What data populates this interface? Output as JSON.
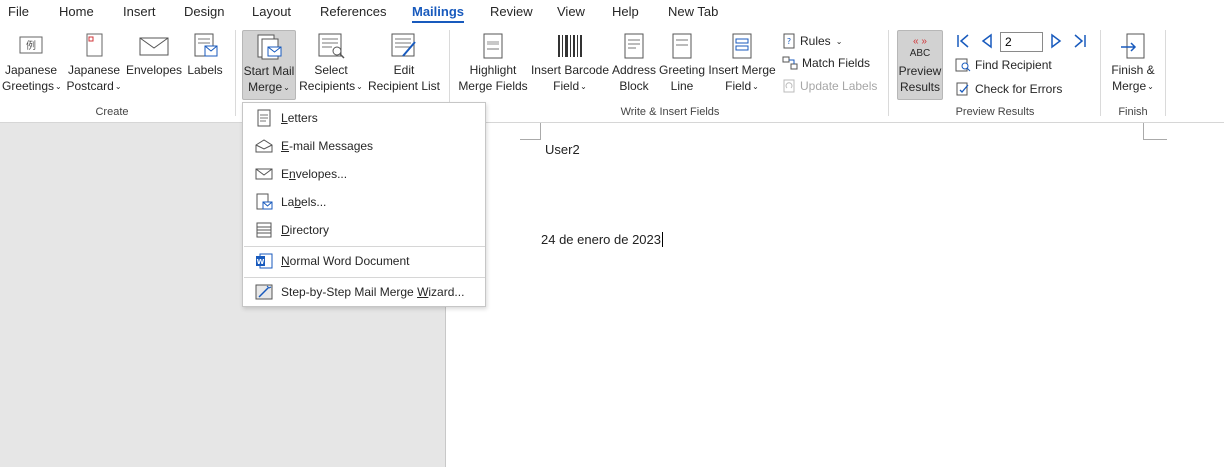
{
  "tabs": [
    "File",
    "Home",
    "Insert",
    "Design",
    "Layout",
    "References",
    "Mailings",
    "Review",
    "View",
    "Help",
    "New Tab"
  ],
  "active_tab": "Mailings",
  "ribbon": {
    "create": {
      "label": "Create",
      "japanese_greetings": [
        "Japanese",
        "Greetings"
      ],
      "japanese_postcard": [
        "Japanese",
        "Postcard"
      ],
      "envelopes": "Envelopes",
      "labels": "Labels"
    },
    "start": {
      "start_mail_merge": [
        "Start Mail",
        "Merge"
      ],
      "select_recipients": [
        "Select",
        "Recipients"
      ],
      "edit_recipient_list": [
        "Edit",
        "Recipient List"
      ]
    },
    "write_insert": {
      "label": "Write & Insert Fields",
      "highlight": [
        "Highlight",
        "Merge Fields"
      ],
      "address_block": [
        "Address",
        "Block"
      ],
      "greeting_line": [
        "Greeting",
        "Line"
      ],
      "insert_merge_field": [
        "Insert Merge",
        "Field"
      ],
      "rules": "Rules",
      "match_fields": "Match Fields",
      "update_labels": "Update Labels",
      "insert_barcode": [
        "Insert Barcode",
        "Field"
      ]
    },
    "preview": {
      "label": "Preview Results",
      "preview_results": [
        "Preview",
        "Results"
      ],
      "abc": "ABC",
      "record": "2",
      "find_recipient": "Find Recipient",
      "check_errors": "Check for Errors"
    },
    "finish": {
      "label": "Finish",
      "finish_merge": [
        "Finish &",
        "Merge"
      ]
    }
  },
  "menu": {
    "letters_u": "L",
    "letters_rest": "etters",
    "email_u": "E",
    "email_rest": "-mail Messages",
    "envelopes_a": "E",
    "envelopes_u": "n",
    "envelopes_rest": "velopes...",
    "labels_a": "La",
    "labels_u": "b",
    "labels_rest": "els...",
    "directory_u": "D",
    "directory_rest": "irectory",
    "normal_u": "N",
    "normal_rest": "ormal Word Document",
    "wizard_a": "Step-by-Step Mail Merge ",
    "wizard_u": "W",
    "wizard_rest": "izard..."
  },
  "document": {
    "user": "User2",
    "date": "24 de enero de 2023"
  },
  "colors": {
    "accent": "#185abd",
    "preview_red": "#d13438"
  }
}
